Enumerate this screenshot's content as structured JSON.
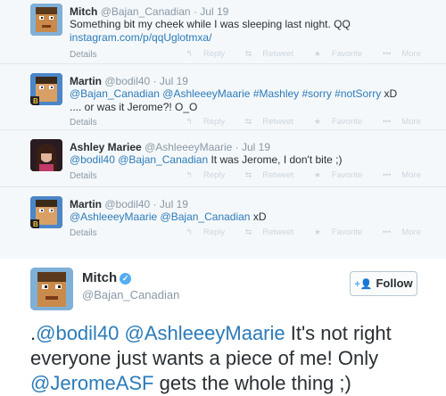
{
  "thread": [
    {
      "name": "Mitch",
      "handle": "@Bajan_Canadian",
      "date": "Jul 19",
      "avatar": "mitch-avatar",
      "line1": "Something bit my cheek while I was sleeping last night. QQ",
      "link": "instagram.com/p/qqUglotmxa/",
      "meta": "Details"
    },
    {
      "name": "Martin",
      "handle": "@bodil40",
      "date": "Jul 19",
      "avatar": "martin-avatar",
      "mentions": "@Bajan_Canadian @AshleeeyMaarie #Mashley #sorry #notSorry",
      "tail": " xD",
      "line2": ".... or was it Jerome?! O_O",
      "meta": "Details"
    },
    {
      "name": "Ashley Mariee",
      "handle": "@AshleeeyMaarie",
      "date": "Jul 19",
      "avatar": "ashley-avatar",
      "mentions": "@bodil40 @Bajan_Canadian",
      "tail": " It was Jerome, I don't bite ;)",
      "meta": "Details"
    },
    {
      "name": "Martin",
      "handle": "@bodil40",
      "date": "Jul 19",
      "avatar": "martin-avatar",
      "mentions": "@AshleeeyMaarie @Bajan_Canadian",
      "tail": " xD",
      "meta": "Details"
    }
  ],
  "actions": {
    "reply": "Reply",
    "retweet": "Retweet",
    "favorite": "Favorite",
    "more": "More"
  },
  "main": {
    "name": "Mitch",
    "handle": "@Bajan_Canadian",
    "follow_label": "Follow",
    "text_prefix": ".",
    "mention1": "@bodil40",
    "mention2": "@AshleeeyMaarie",
    "text_mid": " It's not right everyone just wants a piece of me! Only ",
    "mention3": "@JeromeASF",
    "text_end": " gets the whole thing ;)"
  },
  "colors": {
    "link": "#2b7bb9",
    "verified": "#55acee",
    "thread_bg": "#f5f8fa"
  }
}
